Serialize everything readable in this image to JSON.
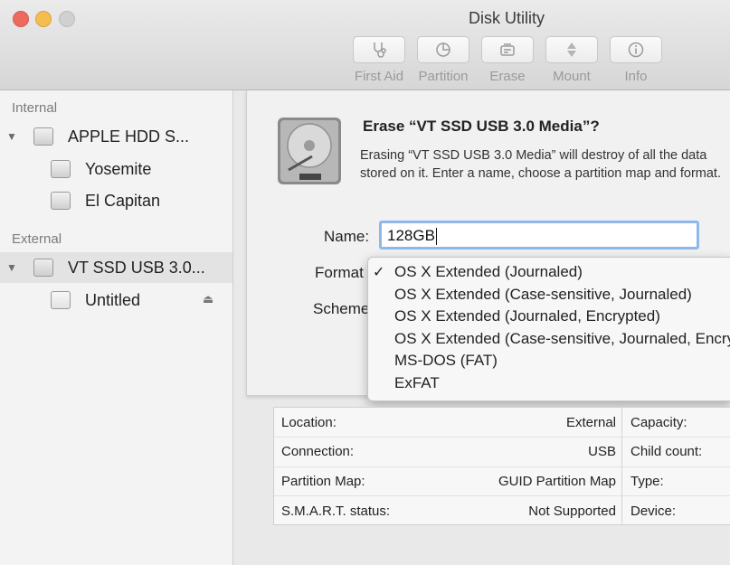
{
  "window": {
    "title": "Disk Utility"
  },
  "toolbar": {
    "items": [
      {
        "label": "First Aid",
        "icon": "stethoscope-icon"
      },
      {
        "label": "Partition",
        "icon": "pie-icon"
      },
      {
        "label": "Erase",
        "icon": "erase-disk-icon"
      },
      {
        "label": "Mount",
        "icon": "mount-icon"
      },
      {
        "label": "Info",
        "icon": "info-icon"
      }
    ]
  },
  "sidebar": {
    "internal_label": "Internal",
    "external_label": "External",
    "internal": [
      {
        "label": "APPLE HDD S..."
      },
      {
        "label": "Yosemite"
      },
      {
        "label": "El Capitan"
      }
    ],
    "external": [
      {
        "label": "VT SSD USB 3.0..."
      },
      {
        "label": "Untitled"
      }
    ]
  },
  "dialog": {
    "title": "Erase “VT SSD USB 3.0 Media”?",
    "description": "Erasing “VT SSD USB 3.0 Media” will destroy of all the data stored on it. Enter a name, choose a partition map and format.",
    "name_label": "Name:",
    "name_value": "128GB",
    "format_label": "Format",
    "scheme_label": "Scheme",
    "check_mark": "✓",
    "format_options": [
      "OS X Extended (Journaled)",
      "OS X Extended (Case-sensitive, Journaled)",
      "OS X Extended (Journaled, Encrypted)",
      "OS X Extended (Case-sensitive, Journaled, Encrypted)",
      "MS-DOS (FAT)",
      "ExFAT"
    ],
    "selected_format": "OS X Extended (Journaled)"
  },
  "info": {
    "rows": [
      {
        "label": "Location:",
        "value": "External",
        "right_label": "Capacity:"
      },
      {
        "label": "Connection:",
        "value": "USB",
        "right_label": "Child count:"
      },
      {
        "label": "Partition Map:",
        "value": "GUID Partition Map",
        "right_label": "Type:"
      },
      {
        "label": "S.M.A.R.T. status:",
        "value": "Not Supported",
        "right_label": "Device:"
      }
    ]
  },
  "colors": {
    "focus_ring": "#8fb8ea",
    "close": "#ee6a5f",
    "minimize": "#f5bd4f",
    "zoom": "#c8c8c8"
  }
}
